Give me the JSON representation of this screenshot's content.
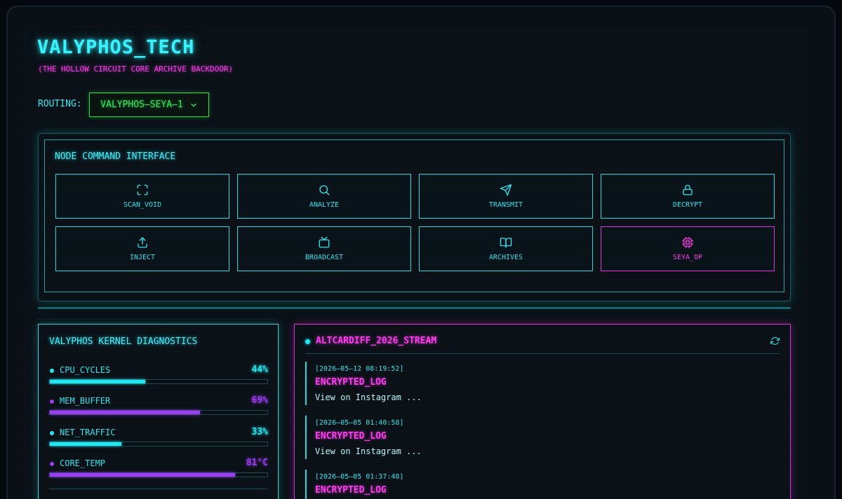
{
  "header": {
    "title": "VALYPHOS_TECH",
    "subtitle": "(THE HOLLOW CIRCUIT CORE ARCHIVE BACKDOOR)"
  },
  "routing": {
    "label": "ROUTING:",
    "selected": "VALYPHOS—SEYA—1"
  },
  "command_panel": {
    "heading": "NODE COMMAND INTERFACE",
    "buttons": [
      {
        "label": "SCAN_VOID",
        "icon": "scan-icon"
      },
      {
        "label": "ANALYZE",
        "icon": "search-icon"
      },
      {
        "label": "TRANSMIT",
        "icon": "send-icon"
      },
      {
        "label": "DECRYPT",
        "icon": "lock-icon"
      },
      {
        "label": "INJECT",
        "icon": "upload-icon"
      },
      {
        "label": "BROADCAST",
        "icon": "tv-icon"
      },
      {
        "label": "ARCHIVES",
        "icon": "book-icon"
      },
      {
        "label": "SEYA_OP",
        "icon": "cpu-icon"
      }
    ]
  },
  "diagnostics": {
    "title": "VALYPHOS KERNEL DIAGNOSTICS",
    "metrics": [
      {
        "label": "CPU_CYCLES",
        "value": "44%",
        "fraction": 0.44,
        "color": "#22e6f0"
      },
      {
        "label": "MEM_BUFFER",
        "value": "69%",
        "fraction": 0.69,
        "color": "#9a3cf0"
      },
      {
        "label": "NET_TRAFFIC",
        "value": "33%",
        "fraction": 0.33,
        "color": "#22e6f0"
      },
      {
        "label": "CORE_TEMP",
        "value": "81°C",
        "fraction": 0.85,
        "color": "#9a3cf0"
      }
    ]
  },
  "stream": {
    "title": "ALTCARDIFF_2026_STREAM",
    "entries": [
      {
        "timestamp": "[2026—05—12 08:19:52]",
        "title": "ENCRYPTED_LOG",
        "body": "View on Instagram ..."
      },
      {
        "timestamp": "[2026—05—05 01:40:58]",
        "title": "ENCRYPTED_LOG",
        "body": "View on Instagram ..."
      },
      {
        "timestamp": "[2026—05—05 01:37:48]",
        "title": "ENCRYPTED_LOG",
        "body": ""
      }
    ]
  },
  "colors": {
    "cyan": "#22e6f0",
    "magenta": "#ff3cf0",
    "green": "#29e34a",
    "purple": "#9a3cf0"
  }
}
